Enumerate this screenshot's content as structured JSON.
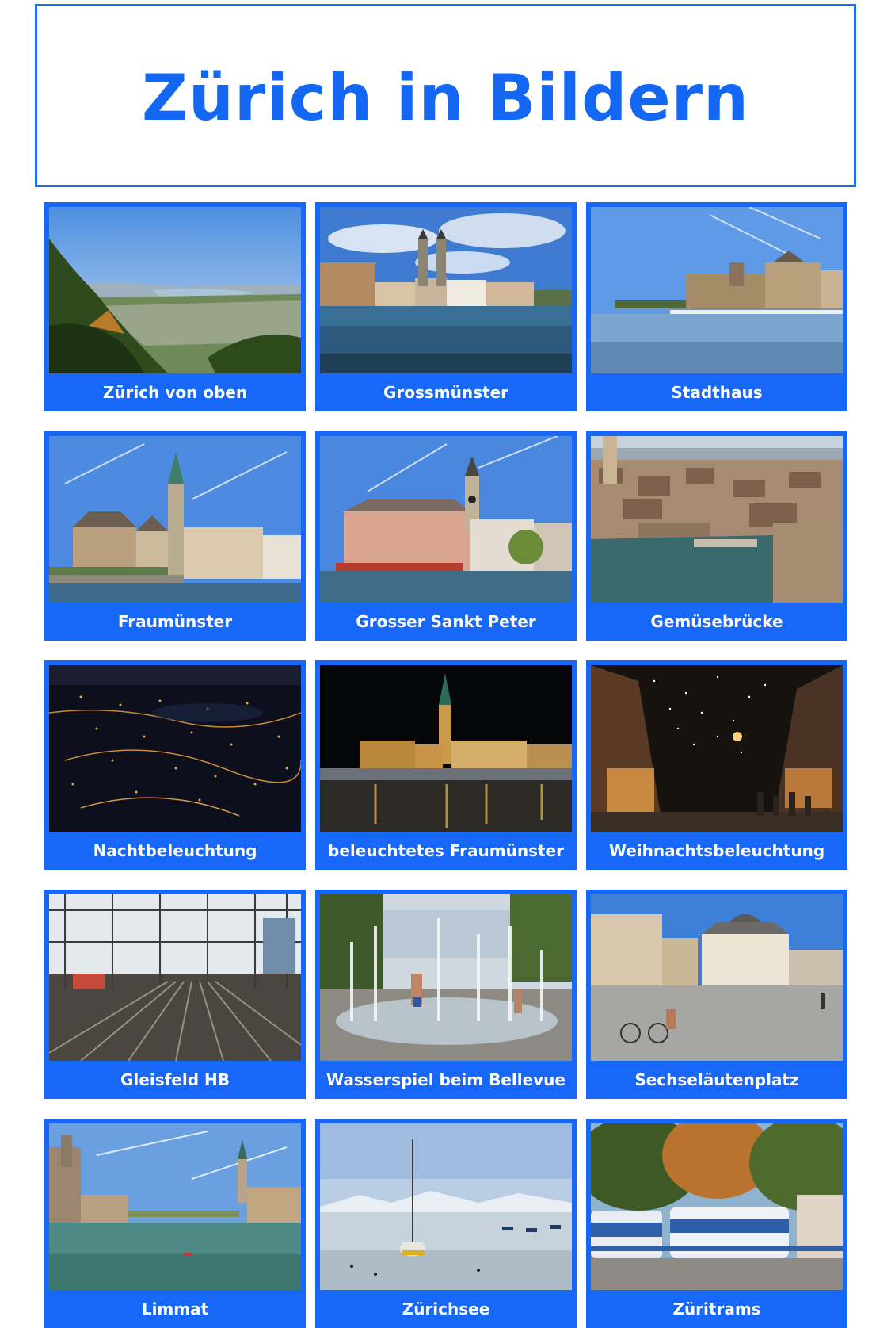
{
  "page": {
    "title": "Zürich in Bildern",
    "accent_color": "#1767f8"
  },
  "gallery": [
    {
      "label": "Zürich von oben"
    },
    {
      "label": "Grossmünster"
    },
    {
      "label": "Stadthaus"
    },
    {
      "label": "Fraumünster"
    },
    {
      "label": "Grosser Sankt Peter"
    },
    {
      "label": "Gemüsebrücke"
    },
    {
      "label": "Nachtbeleuchtung"
    },
    {
      "label": "beleuchtetes Fraumünster"
    },
    {
      "label": "Weihnachtsbeleuchtung"
    },
    {
      "label": "Gleisfeld HB"
    },
    {
      "label": "Wasserspiel beim Bellevue"
    },
    {
      "label": "Sechseläutenplatz"
    },
    {
      "label": "Limmat"
    },
    {
      "label": "Zürichsee"
    },
    {
      "label": "Züritrams"
    }
  ]
}
